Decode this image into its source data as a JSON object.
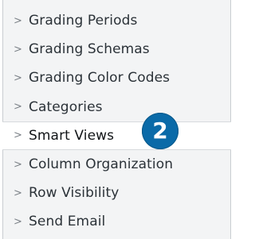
{
  "menu": {
    "items": [
      {
        "label": "Grading Periods",
        "icon": "chevron-right-icon",
        "selected": false
      },
      {
        "label": "Grading Schemas",
        "icon": "chevron-right-icon",
        "selected": false
      },
      {
        "label": "Grading Color Codes",
        "icon": "chevron-right-icon",
        "selected": false
      },
      {
        "label": "Categories",
        "icon": "chevron-right-icon",
        "selected": false
      },
      {
        "label": "Smart Views",
        "icon": "chevron-right-icon",
        "selected": true
      },
      {
        "label": "Column Organization",
        "icon": "chevron-right-icon",
        "selected": false
      },
      {
        "label": "Row Visibility",
        "icon": "chevron-right-icon",
        "selected": false
      },
      {
        "label": "Send Email",
        "icon": "chevron-right-icon",
        "selected": false
      }
    ],
    "chevron_glyph": ">"
  },
  "step_badge": {
    "number": "2",
    "color": "#0a6aa8"
  },
  "colors": {
    "panel_bg": "#f3f4f5",
    "selected_bg": "#ffffff",
    "text": "#2b3238",
    "chevron": "#7b8187"
  }
}
